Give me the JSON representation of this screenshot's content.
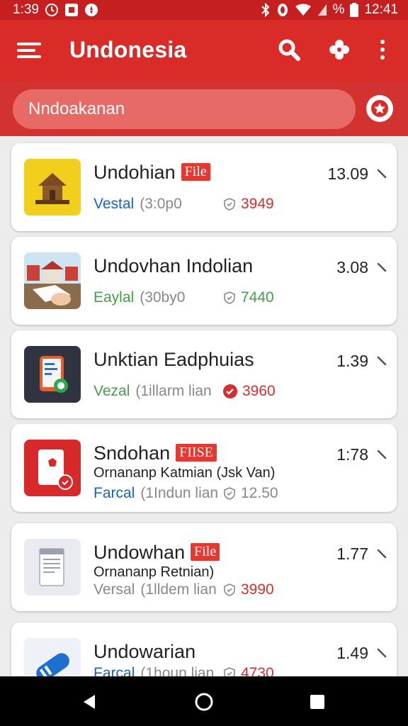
{
  "status": {
    "time_left": "1:39",
    "time_right": "12:41",
    "percent_glyph": "%"
  },
  "app": {
    "title": "Undonesia"
  },
  "search": {
    "value": "Nndoakanan"
  },
  "items": [
    {
      "title": "Undohian",
      "badge": "File",
      "version": "13.09",
      "tag": "Vestal",
      "info": "(3:0p0",
      "stat": "3949",
      "tag_color": "#1565c0",
      "stat_color": "#d32f2f",
      "stat_icon": "shield-outline",
      "icon": "house-icon"
    },
    {
      "title": "Undovhan Indolian",
      "badge": "",
      "version": "3.08",
      "tag": "Eaylal",
      "info": "(30by0",
      "stat": "7440",
      "tag_color": "#43a047",
      "stat_color": "#43a047",
      "stat_icon": "shield-outline",
      "icon": "book-town-icon"
    },
    {
      "title": "Unktian Eadphuias",
      "badge": "",
      "version": "1.39",
      "tag": "Vezal",
      "info": "(1illarm lian",
      "stat": "3960",
      "tag_color": "#43a047",
      "stat_color": "#d32f2f",
      "stat_icon": "check-filled",
      "icon": "phone-app-icon"
    },
    {
      "title": "Sndohan",
      "badge": "FIISE",
      "version": "1:78",
      "subtitle": "Ornananp Katmian (Jsk Van)",
      "tag": "Farcal",
      "info": "(1Indun lian",
      "stat": "12.50",
      "tag_color": "#1565c0",
      "stat_color": "#888888",
      "stat_icon": "shield-outline",
      "icon": "card-app-icon"
    },
    {
      "title": "Undowhan",
      "badge": "File",
      "version": "1.77",
      "subtitle": "Ornananp Retnian)",
      "tag": "Versal",
      "info": "(1lldem lian",
      "stat": "3990",
      "tag_color": "#888888",
      "stat_color": "#d32f2f",
      "stat_icon": "shield-outline",
      "icon": "document-icon"
    },
    {
      "title": "Undowarian",
      "badge": "",
      "version": "1.49",
      "tag": "Farcal",
      "info": "(1houn lian",
      "stat": "4730",
      "tag_color": "#1565c0",
      "stat_color": "#d32f2f",
      "stat_icon": "shield-outline",
      "icon": "pill-icon"
    }
  ],
  "colors": {
    "primary": "#d92b28",
    "status_bar": "#c5201f",
    "accent": "#e23a32"
  }
}
